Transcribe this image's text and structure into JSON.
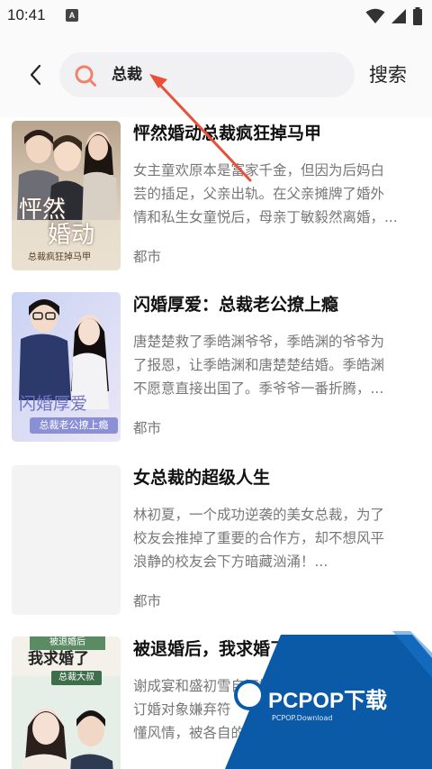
{
  "status_bar": {
    "time": "10:41",
    "app_icon_letter": "A",
    "icons": [
      "wifi-icon",
      "signal-icon",
      "battery-icon"
    ]
  },
  "header": {
    "back_icon": "chevron-left-icon",
    "search_query": "总裁",
    "search_button": "搜索"
  },
  "books": [
    {
      "title": "怦然婚动总裁疯狂掉马甲",
      "description": [
        "女主童欢原本是富家千金，但因为后妈白",
        "芸的插足，父亲出轨。在父亲摊牌了婚外",
        "情和私生女童悦后，母亲丁敏毅然离婚，..."
      ],
      "tag": "都市",
      "cover_text": [
        "怦然",
        "婚动",
        "总裁疯狂掉马甲"
      ]
    },
    {
      "title": "闪婚厚爱：总裁老公撩上瘾",
      "description": [
        "唐楚楚救了季皓渊爷爷，季皓渊的爷爷为",
        "了报恩，让季皓渊和唐楚楚结婚。季皓渊",
        "不愿意直接出国了。季爷爷一番折腾，..."
      ],
      "tag": "都市",
      "cover_text": [
        "闪婚厚爱",
        "总裁老公撩上瘾"
      ]
    },
    {
      "title": "女总裁的超级人生",
      "description": [
        "林初夏，一个成功逆袭的美女总裁，为了",
        "校友会推掉了重要的合作方，却不想风平",
        "浪静的校友会下方暗藏汹涌！..."
      ],
      "tag": "都市",
      "cover_text": []
    },
    {
      "title": "被退婚后，我求婚了",
      "description": [
        "谢成宴和盛初雪自订婚当",
        "订婚对象嫌弃符",
        "懂风情，被各自的订婚对象携手背"
      ],
      "tag": "",
      "cover_text": [
        "被退婚后",
        "我求婚了",
        "总裁大叔"
      ]
    }
  ],
  "watermark": {
    "brand": "PCPOP下载",
    "sub": "PCPOP.Download"
  },
  "colors": {
    "accent": "#e8503a",
    "search_bg": "#f1f1f3",
    "watermark_blue": "#0b5aa8"
  }
}
